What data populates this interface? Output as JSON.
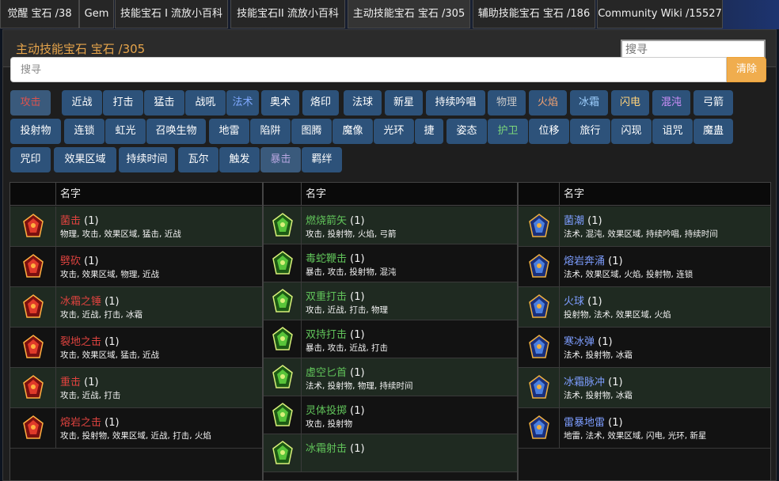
{
  "nav_tabs": [
    {
      "label": "觉醒 宝石 /38"
    },
    {
      "label": "Gem"
    },
    {
      "label": "技能宝石 I 流放小百科"
    },
    {
      "label": "技能宝石II 流放小百科"
    },
    {
      "label": "主动技能宝石 宝石 /305"
    },
    {
      "label": "辅助技能宝石 宝石 /186"
    },
    {
      "label": "Community Wiki /15527"
    }
  ],
  "panel": {
    "title": "主动技能宝石 宝石 /305",
    "search_placeholder": "搜寻"
  },
  "filter": {
    "placeholder": "搜寻",
    "clear_label": "清除"
  },
  "tags": [
    {
      "label": "攻击"
    },
    {
      "label": "近战"
    },
    {
      "label": "打击"
    },
    {
      "label": "猛击"
    },
    {
      "label": "战吼"
    },
    {
      "label": "法术"
    },
    {
      "label": "奥术"
    },
    {
      "label": "烙印"
    },
    {
      "label": "法球"
    },
    {
      "label": "新星"
    },
    {
      "label": "持续吟唱"
    },
    {
      "label": "物理"
    },
    {
      "label": "火焰"
    },
    {
      "label": "冰霜"
    },
    {
      "label": "闪电"
    },
    {
      "label": "混沌"
    },
    {
      "label": "弓箭"
    },
    {
      "label": "投射物"
    },
    {
      "label": "连锁"
    },
    {
      "label": "虹光"
    },
    {
      "label": "召唤生物"
    },
    {
      "label": "地雷"
    },
    {
      "label": "陷阱"
    },
    {
      "label": "图腾"
    },
    {
      "label": "魔像"
    },
    {
      "label": "光环"
    },
    {
      "label": "捷"
    },
    {
      "label": "姿态"
    },
    {
      "label": "护卫"
    },
    {
      "label": "位移"
    },
    {
      "label": "旅行"
    },
    {
      "label": "闪现"
    },
    {
      "label": "诅咒"
    },
    {
      "label": "魔蛊"
    },
    {
      "label": "咒印"
    },
    {
      "label": "效果区域"
    },
    {
      "label": "持续时间"
    },
    {
      "label": "瓦尔"
    },
    {
      "label": "触发"
    },
    {
      "label": "暴击"
    },
    {
      "label": "羁绊"
    }
  ],
  "tables": [
    {
      "header": "名字",
      "rows": [
        {
          "name": "菌击",
          "level": "(1)",
          "tags": "物理, 攻击, 效果区域, 猛击, 近战",
          "color": "red",
          "icon": "strength-gem-icon"
        },
        {
          "name": "劈砍",
          "level": "(1)",
          "tags": "攻击, 效果区域, 物理, 近战",
          "color": "red",
          "icon": "strength-gem-icon"
        },
        {
          "name": "冰霜之锤",
          "level": "(1)",
          "tags": "攻击, 近战, 打击, 冰霜",
          "color": "red",
          "icon": "strength-gem-icon"
        },
        {
          "name": "裂地之击",
          "level": "(1)",
          "tags": "攻击, 效果区域, 猛击, 近战",
          "color": "red",
          "icon": "strength-gem-icon"
        },
        {
          "name": "重击",
          "level": "(1)",
          "tags": "攻击, 近战, 打击",
          "color": "red",
          "icon": "strength-gem-icon"
        },
        {
          "name": "熔岩之击",
          "level": "(1)",
          "tags": "攻击, 投射物, 效果区域, 近战, 打击, 火焰",
          "color": "red",
          "icon": "strength-gem-icon"
        }
      ]
    },
    {
      "header": "名字",
      "rows": [
        {
          "name": "燃烧箭矢",
          "level": "(1)",
          "tags": "攻击, 投射物, 火焰, 弓箭",
          "color": "green",
          "icon": "dexterity-gem-icon"
        },
        {
          "name": "毒蛇鞭击",
          "level": "(1)",
          "tags": "暴击, 攻击, 投射物, 混沌",
          "color": "green",
          "icon": "dexterity-gem-icon"
        },
        {
          "name": "双重打击",
          "level": "(1)",
          "tags": "攻击, 近战, 打击, 物理",
          "color": "green",
          "icon": "dexterity-gem-icon"
        },
        {
          "name": "双持打击",
          "level": "(1)",
          "tags": "暴击, 攻击, 近战, 打击",
          "color": "green",
          "icon": "dexterity-gem-icon"
        },
        {
          "name": "虚空匕首",
          "level": "(1)",
          "tags": "法术, 投射物, 物理, 持续时间",
          "color": "green",
          "icon": "dexterity-gem-icon"
        },
        {
          "name": "灵体投掷",
          "level": "(1)",
          "tags": "攻击, 投射物",
          "color": "green",
          "icon": "dexterity-gem-icon"
        },
        {
          "name": "冰霜射击",
          "level": "(1)",
          "tags": "",
          "color": "green",
          "icon": "dexterity-gem-icon"
        }
      ]
    },
    {
      "header": "名字",
      "rows": [
        {
          "name": "菌潮",
          "level": "(1)",
          "tags": "法术, 混沌, 效果区域, 持续吟唱, 持续时间",
          "color": "blue",
          "icon": "intelligence-gem-icon"
        },
        {
          "name": "熔岩奔涌",
          "level": "(1)",
          "tags": "法术, 效果区域, 火焰, 投射物, 连锁",
          "color": "blue",
          "icon": "intelligence-gem-icon"
        },
        {
          "name": "火球",
          "level": "(1)",
          "tags": "投射物, 法术, 效果区域, 火焰",
          "color": "blue",
          "icon": "intelligence-gem-icon"
        },
        {
          "name": "寒冰弹",
          "level": "(1)",
          "tags": "法术, 投射物, 冰霜",
          "color": "blue",
          "icon": "intelligence-gem-icon"
        },
        {
          "name": "冰霜脉冲",
          "level": "(1)",
          "tags": "法术, 投射物, 冰霜",
          "color": "blue",
          "icon": "intelligence-gem-icon"
        },
        {
          "name": "雷暴地雷",
          "level": "(1)",
          "tags": "地雷, 法术, 效果区域, 闪电, 光环, 新星",
          "color": "blue",
          "icon": "intelligence-gem-icon"
        }
      ]
    }
  ]
}
